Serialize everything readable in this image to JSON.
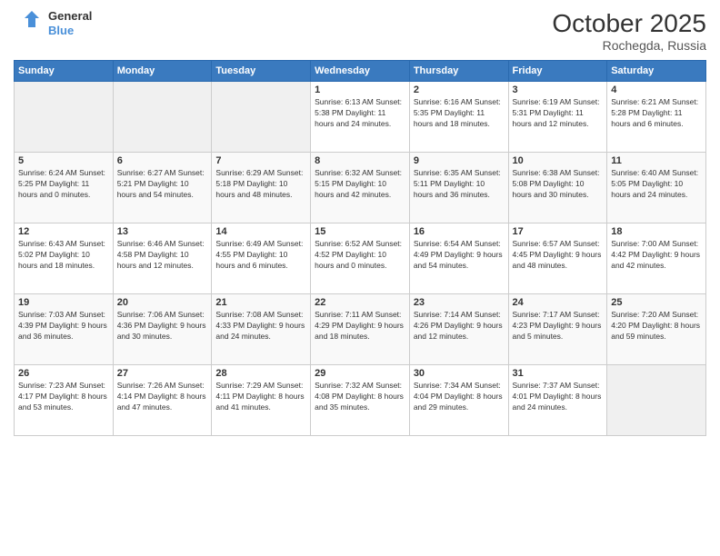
{
  "header": {
    "logo_general": "General",
    "logo_blue": "Blue",
    "month_year": "October 2025",
    "location": "Rochegda, Russia"
  },
  "days_of_week": [
    "Sunday",
    "Monday",
    "Tuesday",
    "Wednesday",
    "Thursday",
    "Friday",
    "Saturday"
  ],
  "weeks": [
    [
      {
        "day": "",
        "info": ""
      },
      {
        "day": "",
        "info": ""
      },
      {
        "day": "",
        "info": ""
      },
      {
        "day": "1",
        "info": "Sunrise: 6:13 AM\nSunset: 5:38 PM\nDaylight: 11 hours\nand 24 minutes."
      },
      {
        "day": "2",
        "info": "Sunrise: 6:16 AM\nSunset: 5:35 PM\nDaylight: 11 hours\nand 18 minutes."
      },
      {
        "day": "3",
        "info": "Sunrise: 6:19 AM\nSunset: 5:31 PM\nDaylight: 11 hours\nand 12 minutes."
      },
      {
        "day": "4",
        "info": "Sunrise: 6:21 AM\nSunset: 5:28 PM\nDaylight: 11 hours\nand 6 minutes."
      }
    ],
    [
      {
        "day": "5",
        "info": "Sunrise: 6:24 AM\nSunset: 5:25 PM\nDaylight: 11 hours\nand 0 minutes."
      },
      {
        "day": "6",
        "info": "Sunrise: 6:27 AM\nSunset: 5:21 PM\nDaylight: 10 hours\nand 54 minutes."
      },
      {
        "day": "7",
        "info": "Sunrise: 6:29 AM\nSunset: 5:18 PM\nDaylight: 10 hours\nand 48 minutes."
      },
      {
        "day": "8",
        "info": "Sunrise: 6:32 AM\nSunset: 5:15 PM\nDaylight: 10 hours\nand 42 minutes."
      },
      {
        "day": "9",
        "info": "Sunrise: 6:35 AM\nSunset: 5:11 PM\nDaylight: 10 hours\nand 36 minutes."
      },
      {
        "day": "10",
        "info": "Sunrise: 6:38 AM\nSunset: 5:08 PM\nDaylight: 10 hours\nand 30 minutes."
      },
      {
        "day": "11",
        "info": "Sunrise: 6:40 AM\nSunset: 5:05 PM\nDaylight: 10 hours\nand 24 minutes."
      }
    ],
    [
      {
        "day": "12",
        "info": "Sunrise: 6:43 AM\nSunset: 5:02 PM\nDaylight: 10 hours\nand 18 minutes."
      },
      {
        "day": "13",
        "info": "Sunrise: 6:46 AM\nSunset: 4:58 PM\nDaylight: 10 hours\nand 12 minutes."
      },
      {
        "day": "14",
        "info": "Sunrise: 6:49 AM\nSunset: 4:55 PM\nDaylight: 10 hours\nand 6 minutes."
      },
      {
        "day": "15",
        "info": "Sunrise: 6:52 AM\nSunset: 4:52 PM\nDaylight: 10 hours\nand 0 minutes."
      },
      {
        "day": "16",
        "info": "Sunrise: 6:54 AM\nSunset: 4:49 PM\nDaylight: 9 hours\nand 54 minutes."
      },
      {
        "day": "17",
        "info": "Sunrise: 6:57 AM\nSunset: 4:45 PM\nDaylight: 9 hours\nand 48 minutes."
      },
      {
        "day": "18",
        "info": "Sunrise: 7:00 AM\nSunset: 4:42 PM\nDaylight: 9 hours\nand 42 minutes."
      }
    ],
    [
      {
        "day": "19",
        "info": "Sunrise: 7:03 AM\nSunset: 4:39 PM\nDaylight: 9 hours\nand 36 minutes."
      },
      {
        "day": "20",
        "info": "Sunrise: 7:06 AM\nSunset: 4:36 PM\nDaylight: 9 hours\nand 30 minutes."
      },
      {
        "day": "21",
        "info": "Sunrise: 7:08 AM\nSunset: 4:33 PM\nDaylight: 9 hours\nand 24 minutes."
      },
      {
        "day": "22",
        "info": "Sunrise: 7:11 AM\nSunset: 4:29 PM\nDaylight: 9 hours\nand 18 minutes."
      },
      {
        "day": "23",
        "info": "Sunrise: 7:14 AM\nSunset: 4:26 PM\nDaylight: 9 hours\nand 12 minutes."
      },
      {
        "day": "24",
        "info": "Sunrise: 7:17 AM\nSunset: 4:23 PM\nDaylight: 9 hours\nand 5 minutes."
      },
      {
        "day": "25",
        "info": "Sunrise: 7:20 AM\nSunset: 4:20 PM\nDaylight: 8 hours\nand 59 minutes."
      }
    ],
    [
      {
        "day": "26",
        "info": "Sunrise: 7:23 AM\nSunset: 4:17 PM\nDaylight: 8 hours\nand 53 minutes."
      },
      {
        "day": "27",
        "info": "Sunrise: 7:26 AM\nSunset: 4:14 PM\nDaylight: 8 hours\nand 47 minutes."
      },
      {
        "day": "28",
        "info": "Sunrise: 7:29 AM\nSunset: 4:11 PM\nDaylight: 8 hours\nand 41 minutes."
      },
      {
        "day": "29",
        "info": "Sunrise: 7:32 AM\nSunset: 4:08 PM\nDaylight: 8 hours\nand 35 minutes."
      },
      {
        "day": "30",
        "info": "Sunrise: 7:34 AM\nSunset: 4:04 PM\nDaylight: 8 hours\nand 29 minutes."
      },
      {
        "day": "31",
        "info": "Sunrise: 7:37 AM\nSunset: 4:01 PM\nDaylight: 8 hours\nand 24 minutes."
      },
      {
        "day": "",
        "info": ""
      }
    ]
  ]
}
